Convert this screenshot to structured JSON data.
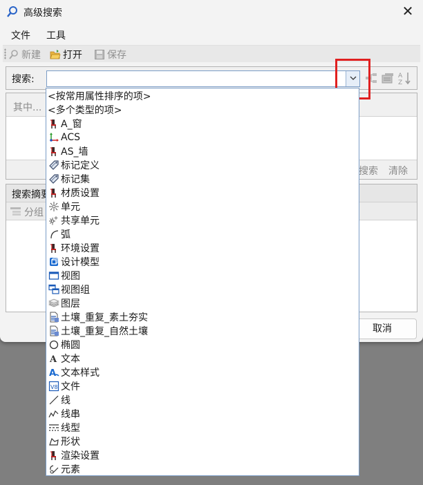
{
  "window": {
    "title": "高级搜索",
    "close_glyph": "✕"
  },
  "menu": [
    "文件",
    "工具"
  ],
  "toolbar": {
    "new": "新建",
    "open": "打开",
    "save": "保存"
  },
  "search": {
    "label": "搜索:",
    "value": ""
  },
  "criteria_panel": {
    "header": "其中...",
    "search_link": "搜索",
    "clear_link": "清除"
  },
  "summary_panel": {
    "header": "搜索摘要",
    "group_label": "分组"
  },
  "buttons": {
    "cancel": "取消"
  },
  "accent_colors": {
    "highlight_box": "#e02020",
    "dropdown_border": "#7a9cc6"
  },
  "dropdown_items": [
    {
      "label": "<按常用属性排序的项>",
      "icon": "none"
    },
    {
      "label": "<多个类型的项>",
      "icon": "none"
    },
    {
      "label": "A_窗",
      "icon": "chair-icon"
    },
    {
      "label": "ACS",
      "icon": "acs-axis-icon"
    },
    {
      "label": "AS_墙",
      "icon": "chair-icon"
    },
    {
      "label": "标记定义",
      "icon": "tag-icon"
    },
    {
      "label": "标记集",
      "icon": "tag-icon"
    },
    {
      "label": "材质设置",
      "icon": "chair-icon"
    },
    {
      "label": "单元",
      "icon": "cell-icon"
    },
    {
      "label": "共享单元",
      "icon": "shared-cell-icon"
    },
    {
      "label": "弧",
      "icon": "arc-icon"
    },
    {
      "label": "环境设置",
      "icon": "chair-icon"
    },
    {
      "label": "设计模型",
      "icon": "model-icon"
    },
    {
      "label": "视图",
      "icon": "view-icon"
    },
    {
      "label": "视图组",
      "icon": "view-group-icon"
    },
    {
      "label": "图层",
      "icon": "layers-icon"
    },
    {
      "label": "土壤_重复_素土夯实",
      "icon": "soil-icon"
    },
    {
      "label": "土壤_重复_自然土壤",
      "icon": "soil-icon"
    },
    {
      "label": "椭圆",
      "icon": "ellipse-icon"
    },
    {
      "label": "文本",
      "icon": "text-icon"
    },
    {
      "label": "文本样式",
      "icon": "text-style-icon"
    },
    {
      "label": "文件",
      "icon": "file-icon"
    },
    {
      "label": "线",
      "icon": "line-icon"
    },
    {
      "label": "线串",
      "icon": "linestring-icon"
    },
    {
      "label": "线型",
      "icon": "linestyle-icon"
    },
    {
      "label": "形状",
      "icon": "shape-icon"
    },
    {
      "label": "渲染设置",
      "icon": "chair-icon"
    },
    {
      "label": "元素",
      "icon": "element-icon"
    }
  ]
}
